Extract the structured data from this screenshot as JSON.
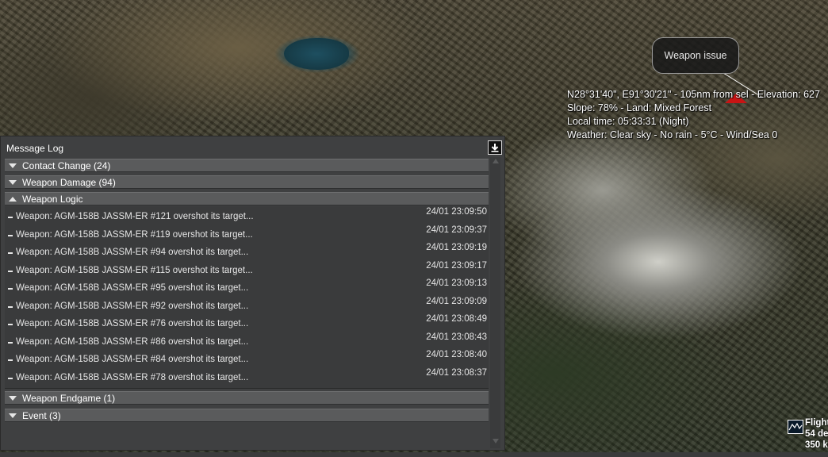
{
  "map": {
    "readout_lines": [
      "N28°31'40\", E91°30'21\" - 105nm from sel - Elevation: 627",
      "Slope: 78%  - Land: Mixed Forest",
      "Local time: 05:33:31 (Night)",
      "Weather: Clear sky - No rain - 5°C - Wind/Sea 0"
    ],
    "bubble_label": "Weapon issue",
    "unit_marker_color": "#c81414"
  },
  "message_log": {
    "title": "Message Log",
    "groups_top": [
      {
        "label": "Contact Change (24)"
      },
      {
        "label": "Weapon Damage (94)"
      },
      {
        "label": "Weapon Logic"
      }
    ],
    "entries": [
      {
        "message": "Weapon: AGM-158B JASSM-ER #121 overshot its target...",
        "time": "24/01 23:09:50"
      },
      {
        "message": "Weapon: AGM-158B JASSM-ER #119 overshot its target...",
        "time": "24/01 23:09:37"
      },
      {
        "message": "Weapon: AGM-158B JASSM-ER #94 overshot its target...",
        "time": "24/01 23:09:19"
      },
      {
        "message": "Weapon: AGM-158B JASSM-ER #115 overshot its target...",
        "time": "24/01 23:09:17"
      },
      {
        "message": "Weapon: AGM-158B JASSM-ER #95 overshot its target...",
        "time": "24/01 23:09:13"
      },
      {
        "message": "Weapon: AGM-158B JASSM-ER #92 overshot its target...",
        "time": "24/01 23:09:09"
      },
      {
        "message": "Weapon: AGM-158B JASSM-ER #76 overshot its target...",
        "time": "24/01 23:08:49"
      },
      {
        "message": "Weapon: AGM-158B JASSM-ER #86 overshot its target...",
        "time": "24/01 23:08:43"
      },
      {
        "message": "Weapon: AGM-158B JASSM-ER #84 overshot its target...",
        "time": "24/01 23:08:40"
      },
      {
        "message": "Weapon: AGM-158B JASSM-ER #78 overshot its target...",
        "time": "24/01 23:08:37"
      }
    ],
    "groups_bottom": [
      {
        "label": "Weapon Endgame (1)"
      },
      {
        "label": "Event (3)"
      }
    ]
  },
  "flight_widget": {
    "lines": [
      "Flight",
      "54 de",
      "350 k"
    ]
  }
}
